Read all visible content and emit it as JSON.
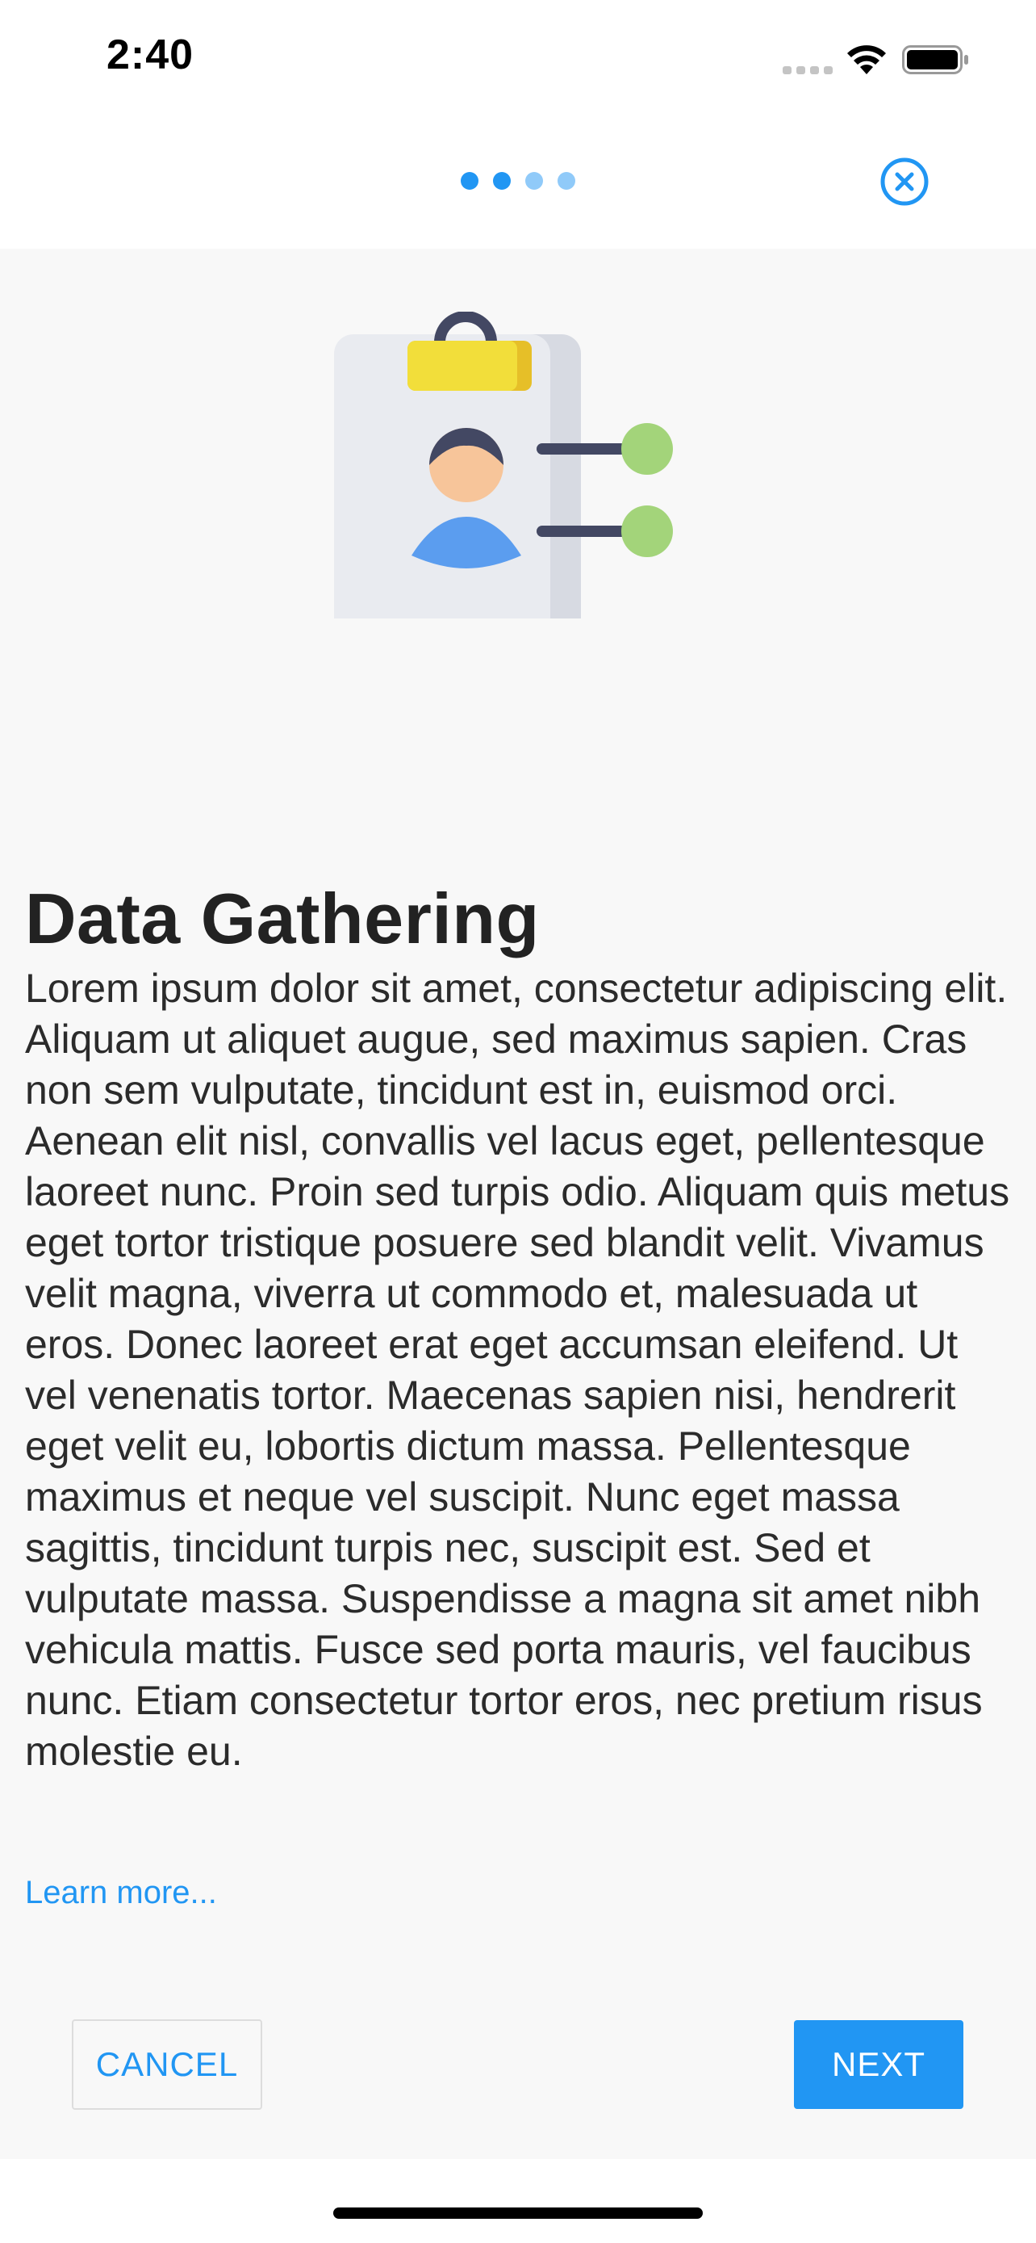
{
  "status_bar": {
    "time": "2:40"
  },
  "pager": {
    "total": 4,
    "active_count": 2,
    "active_color": "#2196f3",
    "inactive_color": "#90caf9"
  },
  "icons": {
    "close": "close-circle-icon",
    "illustration": "clipboard-profile-gear-icon"
  },
  "onboarding": {
    "title": "Data Gathering",
    "body": "Lorem ipsum dolor sit amet, consectetur adipiscing elit. Aliquam ut aliquet augue, sed maximus sapien. Cras non sem vulputate, tincidunt est in, euismod orci. Aenean elit nisl, convallis vel lacus eget, pellentesque laoreet nunc. Proin sed turpis odio. Aliquam quis metus eget tortor tristique posuere sed blandit velit. Vivamus velit magna, viverra ut commodo et, malesuada ut eros. Donec laoreet erat eget accumsan eleifend. Ut vel venenatis tortor. Maecenas sapien nisi, hendrerit eget velit eu, lobortis dictum massa. Pellentesque maximus et neque vel suscipit. Nunc eget massa sagittis, tincidunt turpis nec, suscipit est. Sed et vulputate massa. Suspendisse a magna sit amet nibh vehicula mattis. Fusce sed porta mauris, vel faucibus nunc. Etiam consectetur tortor eros, nec pretium risus molestie eu.",
    "learn_more": "Learn more..."
  },
  "buttons": {
    "cancel": "CANCEL",
    "next": "NEXT"
  },
  "colors": {
    "accent": "#2196f3",
    "content_background": "#f8f8f8"
  }
}
